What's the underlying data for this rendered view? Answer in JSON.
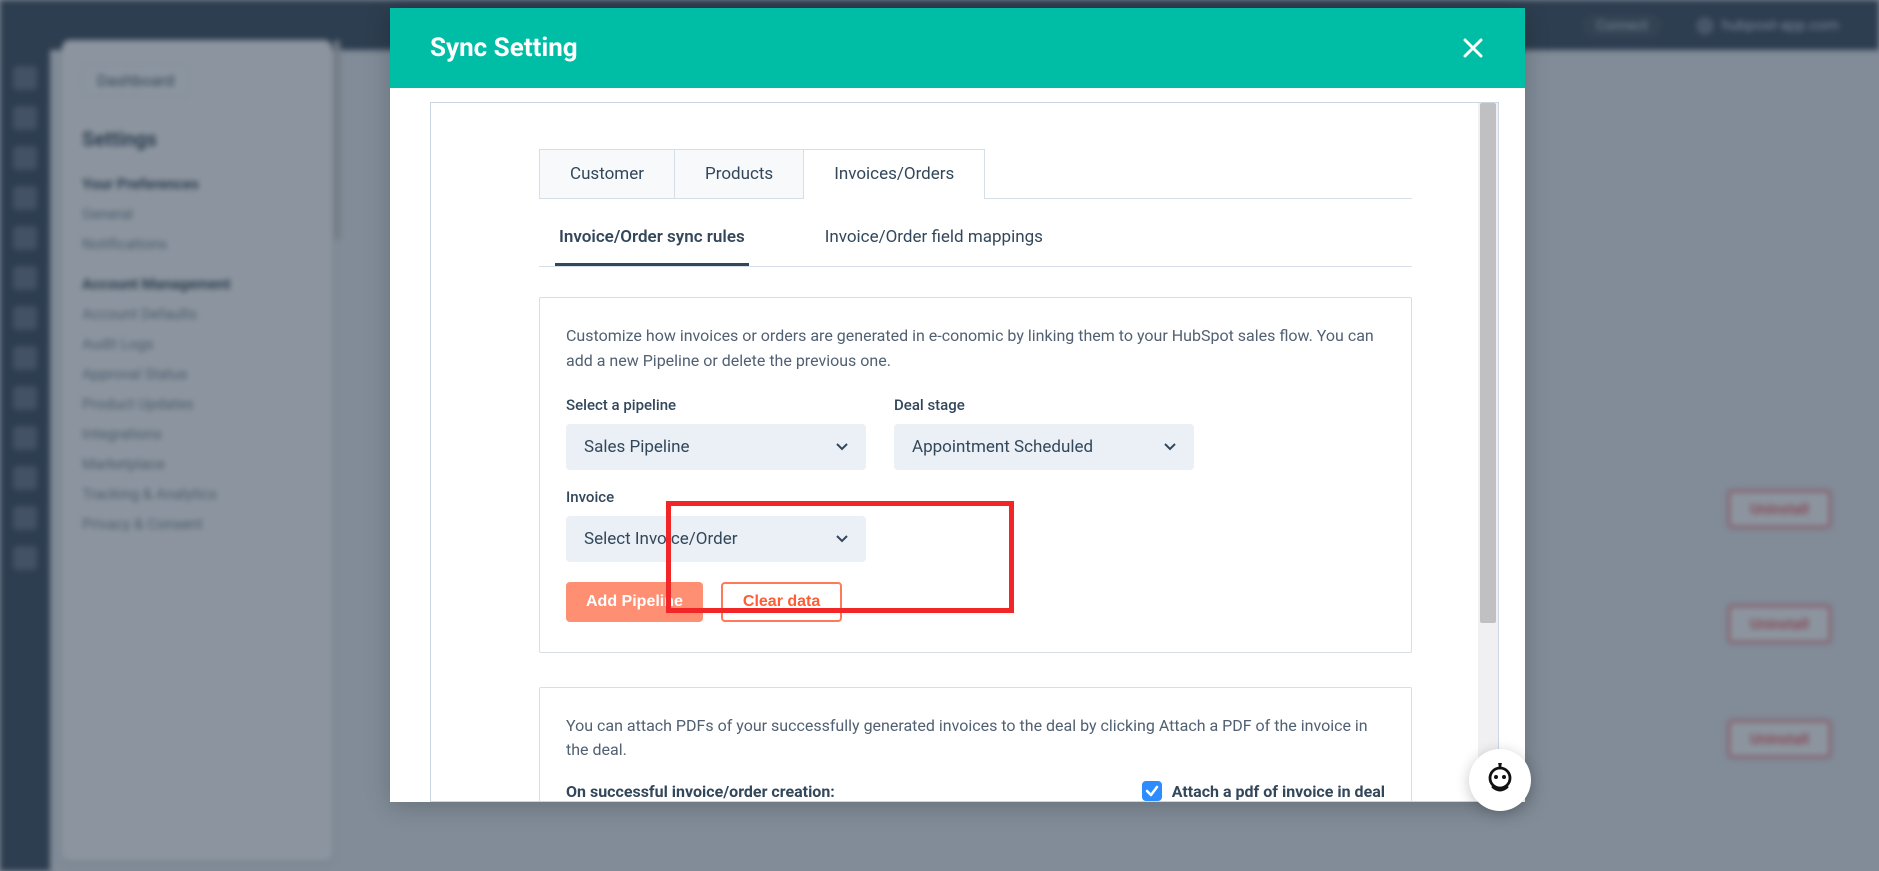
{
  "bg": {
    "topright_pill": "Connect",
    "topright_domain": "hubpost-app.com",
    "dashboard_chip": "Dashboard",
    "settings_hdr": "Settings",
    "cat1": "Your Preferences",
    "nav1": [
      "General",
      "Notifications"
    ],
    "cat2": "Account Management",
    "nav2": [
      "Account Defaults",
      "Audit Logs",
      "Approval Status",
      "Product Updates",
      "Integrations",
      "Marketplace",
      "Tracking & Analytics",
      "Privacy & Consent"
    ],
    "right_btns": [
      "Uninstall",
      "Uninstall",
      "Uninstall"
    ]
  },
  "modal": {
    "title": "Sync Setting"
  },
  "tabs_major": [
    "Customer",
    "Products",
    "Invoices/Orders"
  ],
  "tabs_major_active_index": 2,
  "tabs_minor": [
    "Invoice/Order sync rules",
    "Invoice/Order field mappings"
  ],
  "tabs_minor_active_index": 0,
  "card1": {
    "desc": "Customize how invoices or orders are generated in e-conomic by linking them to your HubSpot sales flow. You can add a new Pipeline or delete the previous one.",
    "pipeline_label": "Select a pipeline",
    "pipeline_value": "Sales Pipeline",
    "stage_label": "Deal stage",
    "stage_value": "Appointment Scheduled",
    "invoice_label": "Invoice",
    "invoice_value": "Select Invoice/Order",
    "add_pipeline": "Add Pipeline",
    "clear_data": "Clear data"
  },
  "card2": {
    "desc": "You can attach PDFs of your successfully generated invoices to the deal by clicking Attach a PDF of the invoice in the deal.",
    "left_label": "On successful invoice/order creation:",
    "check_label": "Attach a pdf of invoice in deal"
  }
}
